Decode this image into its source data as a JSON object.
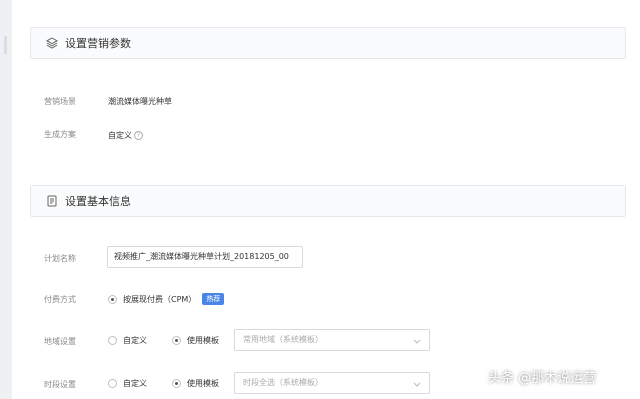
{
  "section_marketing": {
    "title": "设置营销参数",
    "scene_label": "营销场景",
    "scene_value": "潮流媒体曝光种草",
    "plan_label": "生成方案",
    "plan_value": "自定义",
    "help_glyph": "?"
  },
  "section_basic": {
    "title": "设置基本信息",
    "plan_name_label": "计划名称",
    "plan_name_value": "视频推广_潮流媒体曝光种草计划_20181205_00",
    "payment_label": "付费方式",
    "payment_option": "按展现付费（CPM）",
    "payment_badge": "热荐",
    "region_label": "地域设置",
    "region_custom": "自定义",
    "region_template": "使用模板",
    "region_select_value": "常用地域（系统模板）",
    "time_label": "时段设置",
    "time_custom": "自定义",
    "time_template": "使用模板",
    "time_select_value": "时段全选（系统模板）"
  },
  "watermark": "头条 @那木说运营"
}
